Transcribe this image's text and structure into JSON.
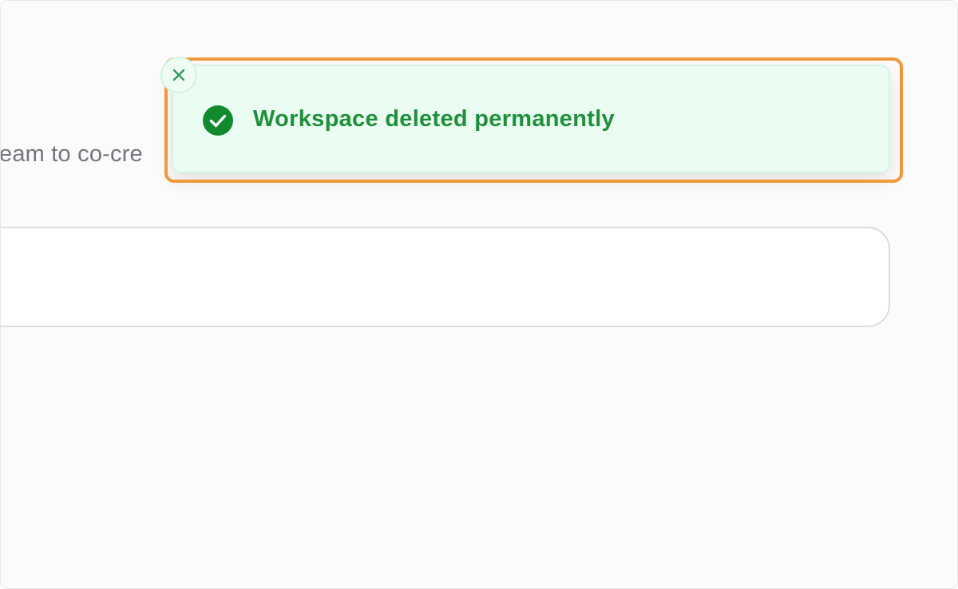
{
  "background": {
    "description_text": "eam to co-cre",
    "input_value": ""
  },
  "toast": {
    "message": "Workspace deleted permanently",
    "status": "success",
    "icon": "check-circle-icon",
    "close_icon": "close-icon",
    "colors": {
      "text": "#1f8f3a",
      "icon_fill": "#118a2e",
      "background": "#ebfdf2",
      "highlight": "#f0993a"
    }
  }
}
